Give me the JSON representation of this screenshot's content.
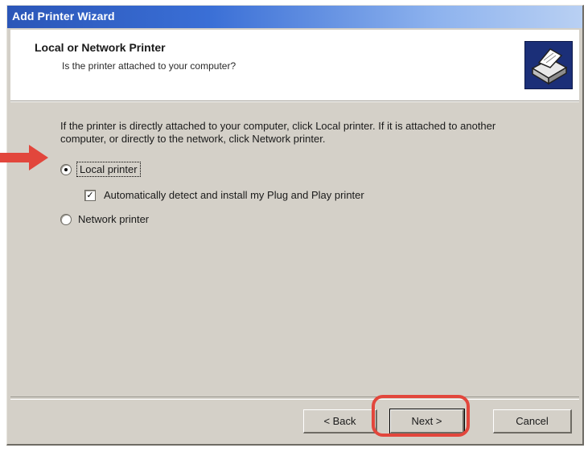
{
  "window": {
    "title": "Add Printer Wizard"
  },
  "header": {
    "title": "Local or Network Printer",
    "subtitle": "Is the printer attached to your computer?",
    "icon": "printer-icon"
  },
  "main": {
    "instruction": "If the printer is directly attached to your computer, click Local printer.  If it is attached to another computer, or directly to the network, click Network printer.",
    "options": [
      {
        "label": "Local printer",
        "selected": true
      },
      {
        "label": "Automatically detect and install my Plug and Play printer",
        "checked": true
      },
      {
        "label": "Network printer",
        "selected": false
      }
    ]
  },
  "buttons": {
    "back_label": "< Back",
    "next_label": "Next >",
    "cancel_label": "Cancel"
  },
  "annotation": {
    "arrow_color": "#e2463c",
    "highlight_color": "#e2463c"
  }
}
